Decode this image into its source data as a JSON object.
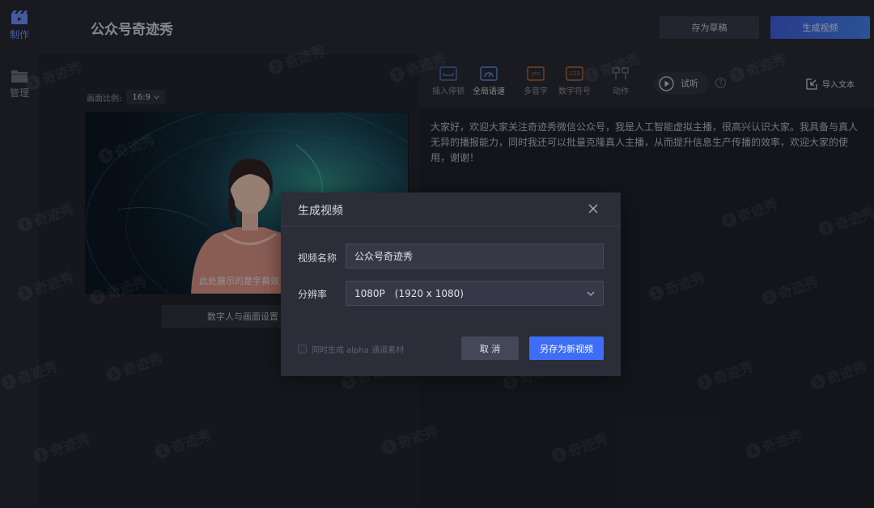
{
  "nav": {
    "make_label": "制作",
    "manage_label": "管理"
  },
  "header": {
    "title": "公众号奇迹秀",
    "draft_label": "存为草稿",
    "generate_label": "生成视频"
  },
  "preview": {
    "ratio_label": "画面比例:",
    "ratio_value": "16:9",
    "subtitle": "此处展示的是字幕效",
    "settings_button": "数字人与画面设置"
  },
  "toolbar": {
    "insert_pause": "插入停顿",
    "global_speed": "全局语速",
    "polyphone": "多音字",
    "digit_symbol": "数字符号",
    "action": "动作",
    "trial_label": "试听",
    "help_icon": "?",
    "import_label": "导入文本",
    "polyphone_badge": "yin",
    "digit_badge": "123"
  },
  "script": {
    "text": "大家好，欢迎大家关注奇迹秀微信公众号，我是人工智能虚拟主播，很高兴认识大家。我具备与真人无异的播报能力，同时我还可以批量克隆真人主播，从而提升信息生产传播的效率，欢迎大家的使用，谢谢！"
  },
  "modal": {
    "title": "生成视频",
    "name_label": "视频名称",
    "name_value": "公众号奇迹秀",
    "resolution_label": "分辨率",
    "resolution_value": "1080P　(1920 x 1080)",
    "alpha_label": "同时生成 alpha 通道素材",
    "cancel_label": "取 消",
    "save_as_label": "另存为新视频"
  },
  "watermark": {
    "logo_char": "1",
    "text": "奇迹秀"
  },
  "colors": {
    "accent": "#3d6ef5",
    "nav_active": "#6b8cff",
    "panel": "#25262d",
    "modal": "#2b2d39"
  }
}
